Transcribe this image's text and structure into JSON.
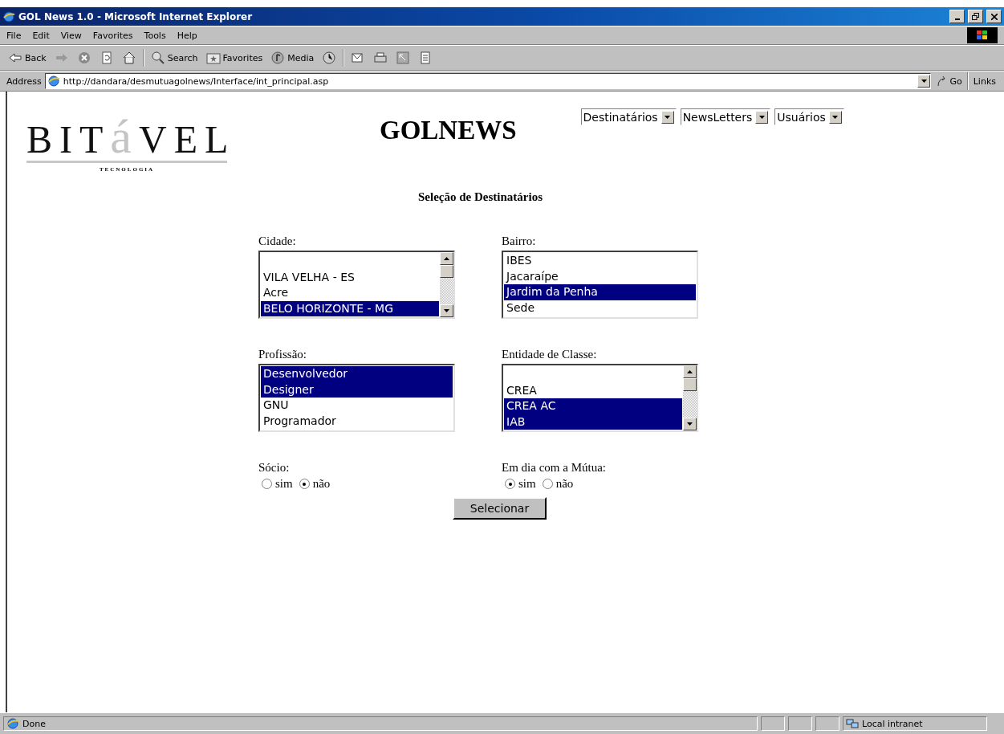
{
  "window": {
    "title": "GOL News 1.0 - Microsoft Internet Explorer"
  },
  "menu": [
    "File",
    "Edit",
    "View",
    "Favorites",
    "Tools",
    "Help"
  ],
  "toolbar": [
    {
      "kind": "back",
      "label": "Back"
    },
    {
      "kind": "forward"
    },
    {
      "kind": "stop"
    },
    {
      "kind": "refresh"
    },
    {
      "kind": "home"
    },
    {
      "kind": "search",
      "label": "Search"
    },
    {
      "kind": "favorites",
      "label": "Favorites"
    },
    {
      "kind": "media",
      "label": "Media"
    },
    {
      "kind": "history"
    },
    {
      "kind": "mail"
    },
    {
      "kind": "print"
    },
    {
      "kind": "edit"
    },
    {
      "kind": "discuss"
    }
  ],
  "address": {
    "label": "Address",
    "url": "http://dandara/desmutuagolnews/Interface/int_principal.asp",
    "go": "Go",
    "links": "Links"
  },
  "page": {
    "logo": {
      "before": "BIT",
      "accent": "á",
      "after": "VEL",
      "tagline": "TECNOLOGIA"
    },
    "title": "GOLNEWS",
    "nav_dropdowns": [
      "Destinatários",
      "NewsLetters",
      "Usuários"
    ],
    "heading": "Seleção de Destinatários",
    "lists": [
      {
        "label": "Cidade:",
        "scrollbar": true,
        "items": [
          {
            "label": "VILA VELHA - ES",
            "selected": false
          },
          {
            "label": "Acre",
            "selected": false
          },
          {
            "label": "BELO HORIZONTE - MG",
            "selected": true
          }
        ]
      },
      {
        "label": "Bairro:",
        "scrollbar": false,
        "items": [
          {
            "label": "IBES",
            "selected": false
          },
          {
            "label": "Jacaraípe",
            "selected": false
          },
          {
            "label": "Jardim da Penha",
            "selected": true
          },
          {
            "label": "Sede",
            "selected": false
          }
        ]
      },
      {
        "label": "Profissão:",
        "scrollbar": false,
        "items": [
          {
            "label": "Desenvolvedor",
            "selected": true
          },
          {
            "label": "Designer",
            "selected": true
          },
          {
            "label": "GNU",
            "selected": false
          },
          {
            "label": "Programador",
            "selected": false
          }
        ]
      },
      {
        "label": "Entidade de Classe:",
        "scrollbar": true,
        "items": [
          {
            "label": "CREA",
            "selected": false
          },
          {
            "label": "CREA AC",
            "selected": true
          },
          {
            "label": "IAB",
            "selected": true
          }
        ]
      }
    ],
    "radio_groups": [
      {
        "label": "Sócio:",
        "options": [
          {
            "label": "sim",
            "selected": false
          },
          {
            "label": "não",
            "selected": true
          }
        ]
      },
      {
        "label": "Em dia com a Mútua:",
        "options": [
          {
            "label": "sim",
            "selected": true
          },
          {
            "label": "não",
            "selected": false
          }
        ]
      }
    ],
    "submit": "Selecionar"
  },
  "status_bar": {
    "text": "Done",
    "zone": "Local intranet"
  }
}
